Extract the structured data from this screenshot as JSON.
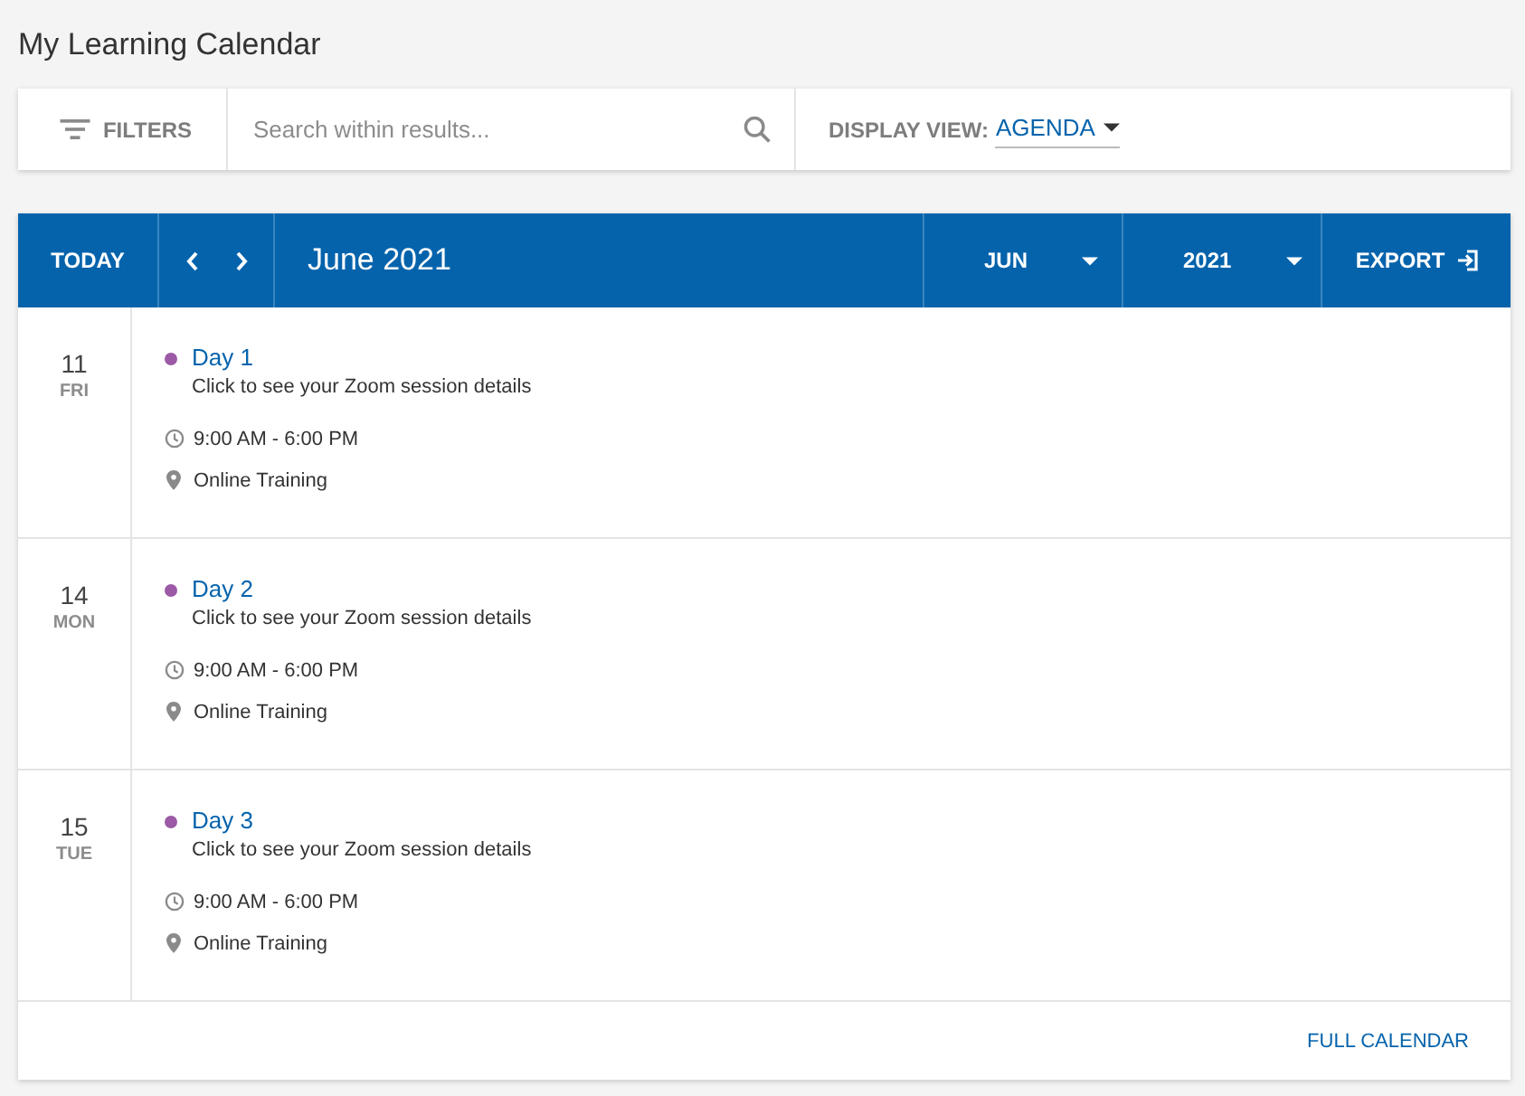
{
  "page": {
    "title": "My Learning Calendar"
  },
  "toolbar": {
    "filters_label": "FILTERS",
    "search": {
      "placeholder": "Search within results..."
    },
    "display_view": {
      "label": "DISPLAY VIEW:",
      "value": "AGENDA"
    }
  },
  "calendar_header": {
    "today_button": "TODAY",
    "title": "June 2021",
    "month_select": "JUN",
    "year_select": "2021",
    "export_button": "EXPORT"
  },
  "agenda": [
    {
      "day": "11",
      "weekday": "FRI",
      "events": [
        {
          "title": "Day 1",
          "color": "#9b59a6",
          "description": "Click to see your Zoom session details",
          "time": "9:00 AM - 6:00 PM",
          "location": "Online Training"
        }
      ]
    },
    {
      "day": "14",
      "weekday": "MON",
      "events": [
        {
          "title": "Day 2",
          "color": "#9b59a6",
          "description": "Click to see your Zoom session details",
          "time": "9:00 AM - 6:00 PM",
          "location": "Online Training"
        }
      ]
    },
    {
      "day": "15",
      "weekday": "TUE",
      "events": [
        {
          "title": "Day 3",
          "color": "#9b59a6",
          "description": "Click to see your Zoom session details",
          "time": "9:00 AM - 6:00 PM",
          "location": "Online Training"
        }
      ]
    }
  ],
  "footer": {
    "link": "FULL CALENDAR"
  }
}
